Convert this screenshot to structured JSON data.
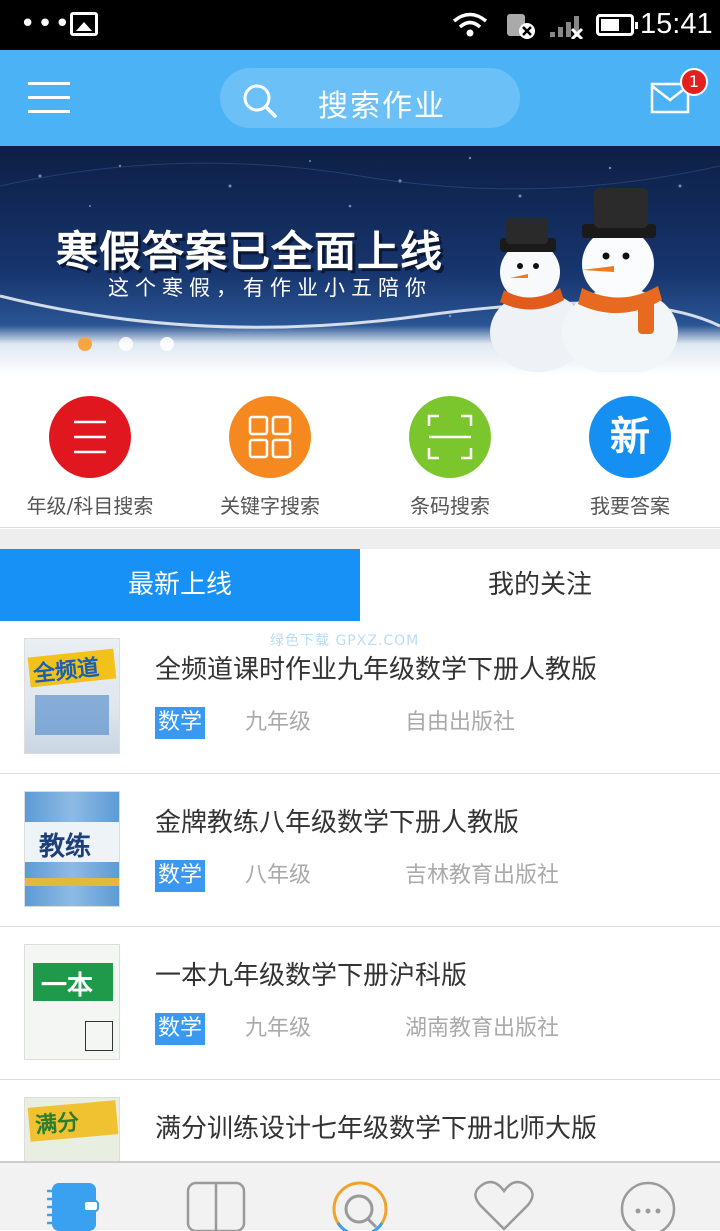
{
  "status_bar": {
    "time": "15:41",
    "dots": "•••"
  },
  "header": {
    "search_placeholder": "搜索作业",
    "badge_count": "1"
  },
  "banner": {
    "title": "寒假答案已全面上线",
    "subtitle": "这个寒假，有作业小五陪你",
    "dots": 3,
    "active_dot": 0
  },
  "actions": [
    {
      "label": "年级/科目搜索",
      "icon": "list-icon",
      "color": "#e0171f"
    },
    {
      "label": "关键字搜索",
      "icon": "grid-icon",
      "color": "#f5891f"
    },
    {
      "label": "条码搜索",
      "icon": "barcode-scan-icon",
      "color": "#7cc62d"
    },
    {
      "label": "我要答案",
      "icon": "new-icon",
      "color": "#1590f2",
      "glyph": "新"
    }
  ],
  "tabs": {
    "latest": "最新上线",
    "following": "我的关注"
  },
  "watermark": "绿色下载 GPXZ.COM",
  "books": [
    {
      "title": "全频道课时作业九年级数学下册人教版",
      "subject": "数学",
      "grade": "九年级",
      "publisher": "自由出版社",
      "cover_text": "全频道"
    },
    {
      "title": "金牌教练八年级数学下册人教版",
      "subject": "数学",
      "grade": "八年级",
      "publisher": "吉林教育出版社",
      "cover_text": "教练"
    },
    {
      "title": "一本九年级数学下册沪科版",
      "subject": "数学",
      "grade": "九年级",
      "publisher": "湖南教育出版社",
      "cover_text": "一本"
    },
    {
      "title": "满分训练设计七年级数学下册北师大版",
      "subject": "",
      "grade": "",
      "publisher": "",
      "cover_text": "满分"
    }
  ],
  "bottom_nav": [
    {
      "icon": "notebook-icon",
      "color": "#3aa0f0"
    },
    {
      "icon": "book-icon",
      "color": "#9a9a9a"
    },
    {
      "icon": "search-icon",
      "color": "#9a9a9a"
    },
    {
      "icon": "heart-icon",
      "color": "#9a9a9a"
    },
    {
      "icon": "chat-icon",
      "color": "#9a9a9a"
    }
  ]
}
